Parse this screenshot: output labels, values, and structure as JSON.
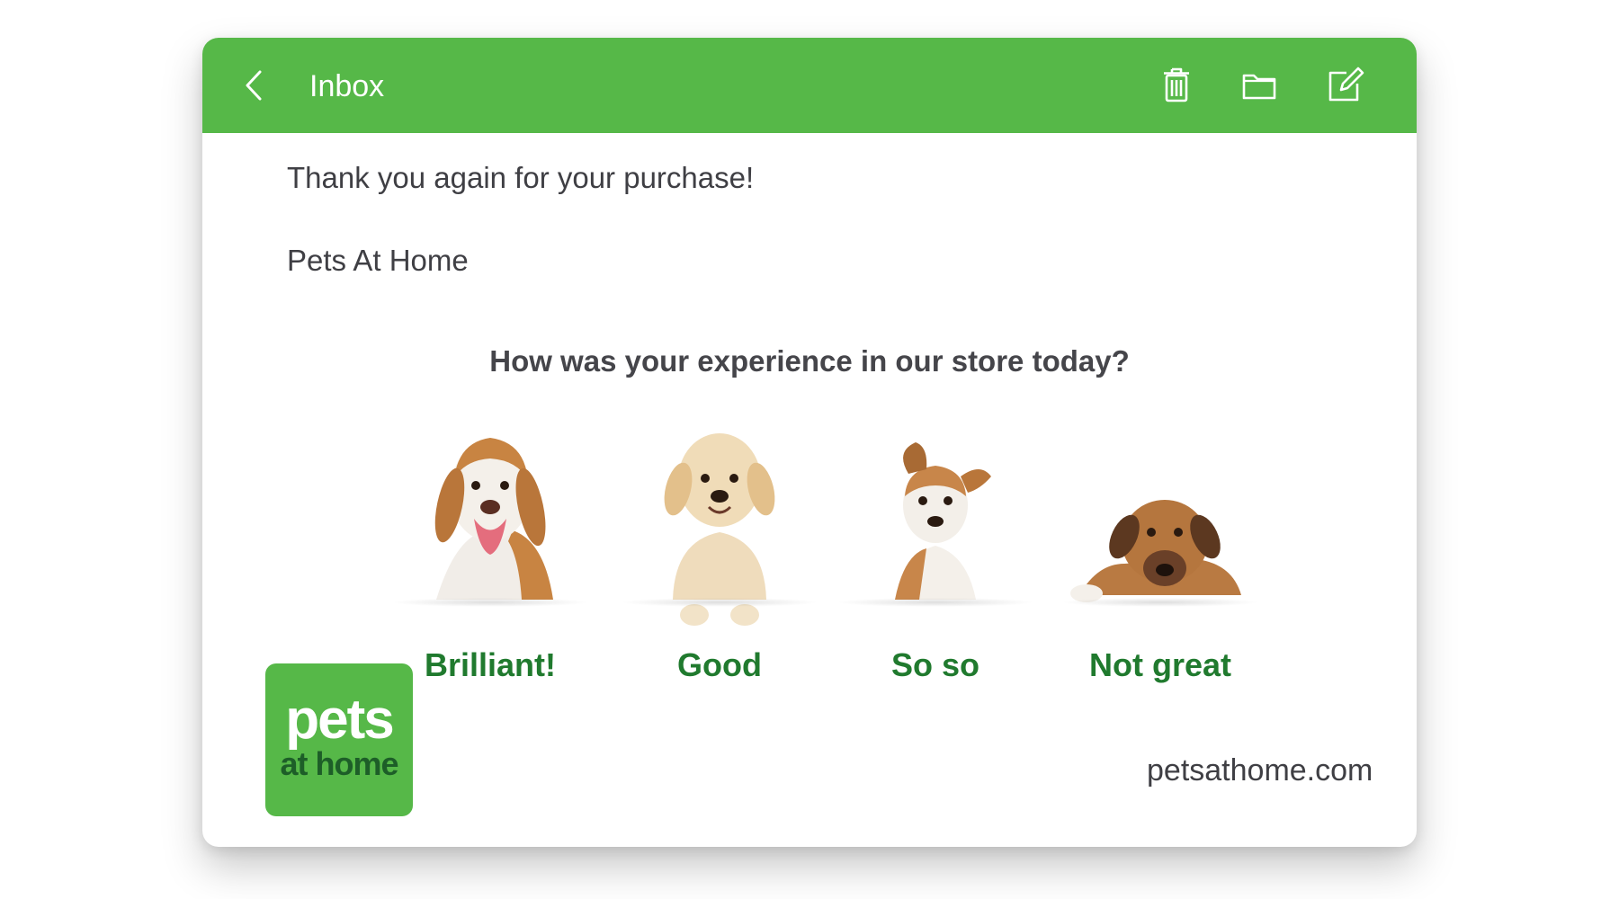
{
  "header": {
    "title": "Inbox",
    "back_icon": "chevron-left-icon",
    "actions": [
      "trash-icon",
      "folder-icon",
      "compose-icon"
    ]
  },
  "message": {
    "line1": "Thank you again for your purchase!",
    "sender": "Pets At Home"
  },
  "survey": {
    "question": "How was your experience in our store today?",
    "options": [
      {
        "label": "Brilliant!",
        "image": "happy-beagle-image"
      },
      {
        "label": "Good",
        "image": "golden-puppy-image"
      },
      {
        "label": "So so",
        "image": "terrier-puppy-image"
      },
      {
        "label": "Not great",
        "image": "sad-dog-image"
      }
    ]
  },
  "footer": {
    "logo_line1": "pets",
    "logo_line2": "at home",
    "website": "petsathome.com"
  },
  "colors": {
    "brand_green": "#56b848",
    "label_green": "#207a2e",
    "text_dark": "#3f3f44"
  }
}
